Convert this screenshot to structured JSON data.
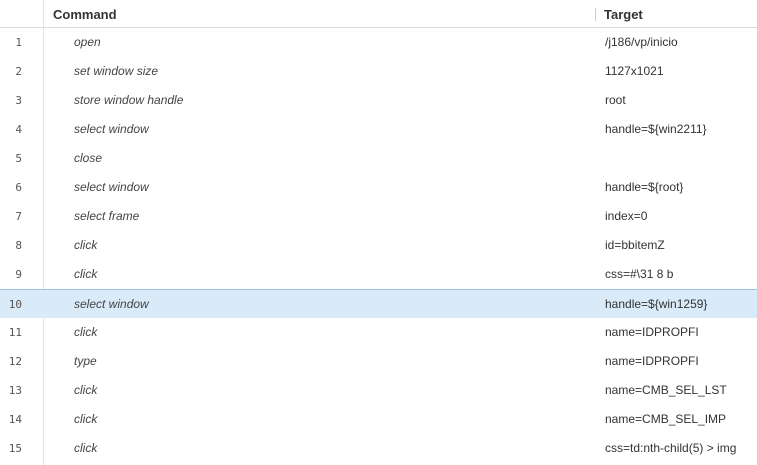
{
  "header": {
    "command_label": "Command",
    "target_label": "Target"
  },
  "colors": {
    "selected_row_bg": "#d9eaf9",
    "selected_row_border": "#9cc2e5"
  },
  "selected_row_index": 9,
  "rows": [
    {
      "num": "1",
      "command": "open",
      "target": "/j186/vp/inicio"
    },
    {
      "num": "2",
      "command": "set window size",
      "target": "1127x1021"
    },
    {
      "num": "3",
      "command": "store window handle",
      "target": "root"
    },
    {
      "num": "4",
      "command": "select window",
      "target": "handle=${win2211}"
    },
    {
      "num": "5",
      "command": "close",
      "target": ""
    },
    {
      "num": "6",
      "command": "select window",
      "target": "handle=${root}"
    },
    {
      "num": "7",
      "command": "select frame",
      "target": "index=0"
    },
    {
      "num": "8",
      "command": "click",
      "target": "id=bbitemZ"
    },
    {
      "num": "9",
      "command": "click",
      "target": "css=#\\31 8 b"
    },
    {
      "num": "10",
      "command": "select window",
      "target": "handle=${win1259}"
    },
    {
      "num": "11",
      "command": "click",
      "target": "name=IDPROPFI"
    },
    {
      "num": "12",
      "command": "type",
      "target": "name=IDPROPFI"
    },
    {
      "num": "13",
      "command": "click",
      "target": "name=CMB_SEL_LST"
    },
    {
      "num": "14",
      "command": "click",
      "target": "name=CMB_SEL_IMP"
    },
    {
      "num": "15",
      "command": "click",
      "target": "css=td:nth-child(5) > img"
    }
  ]
}
